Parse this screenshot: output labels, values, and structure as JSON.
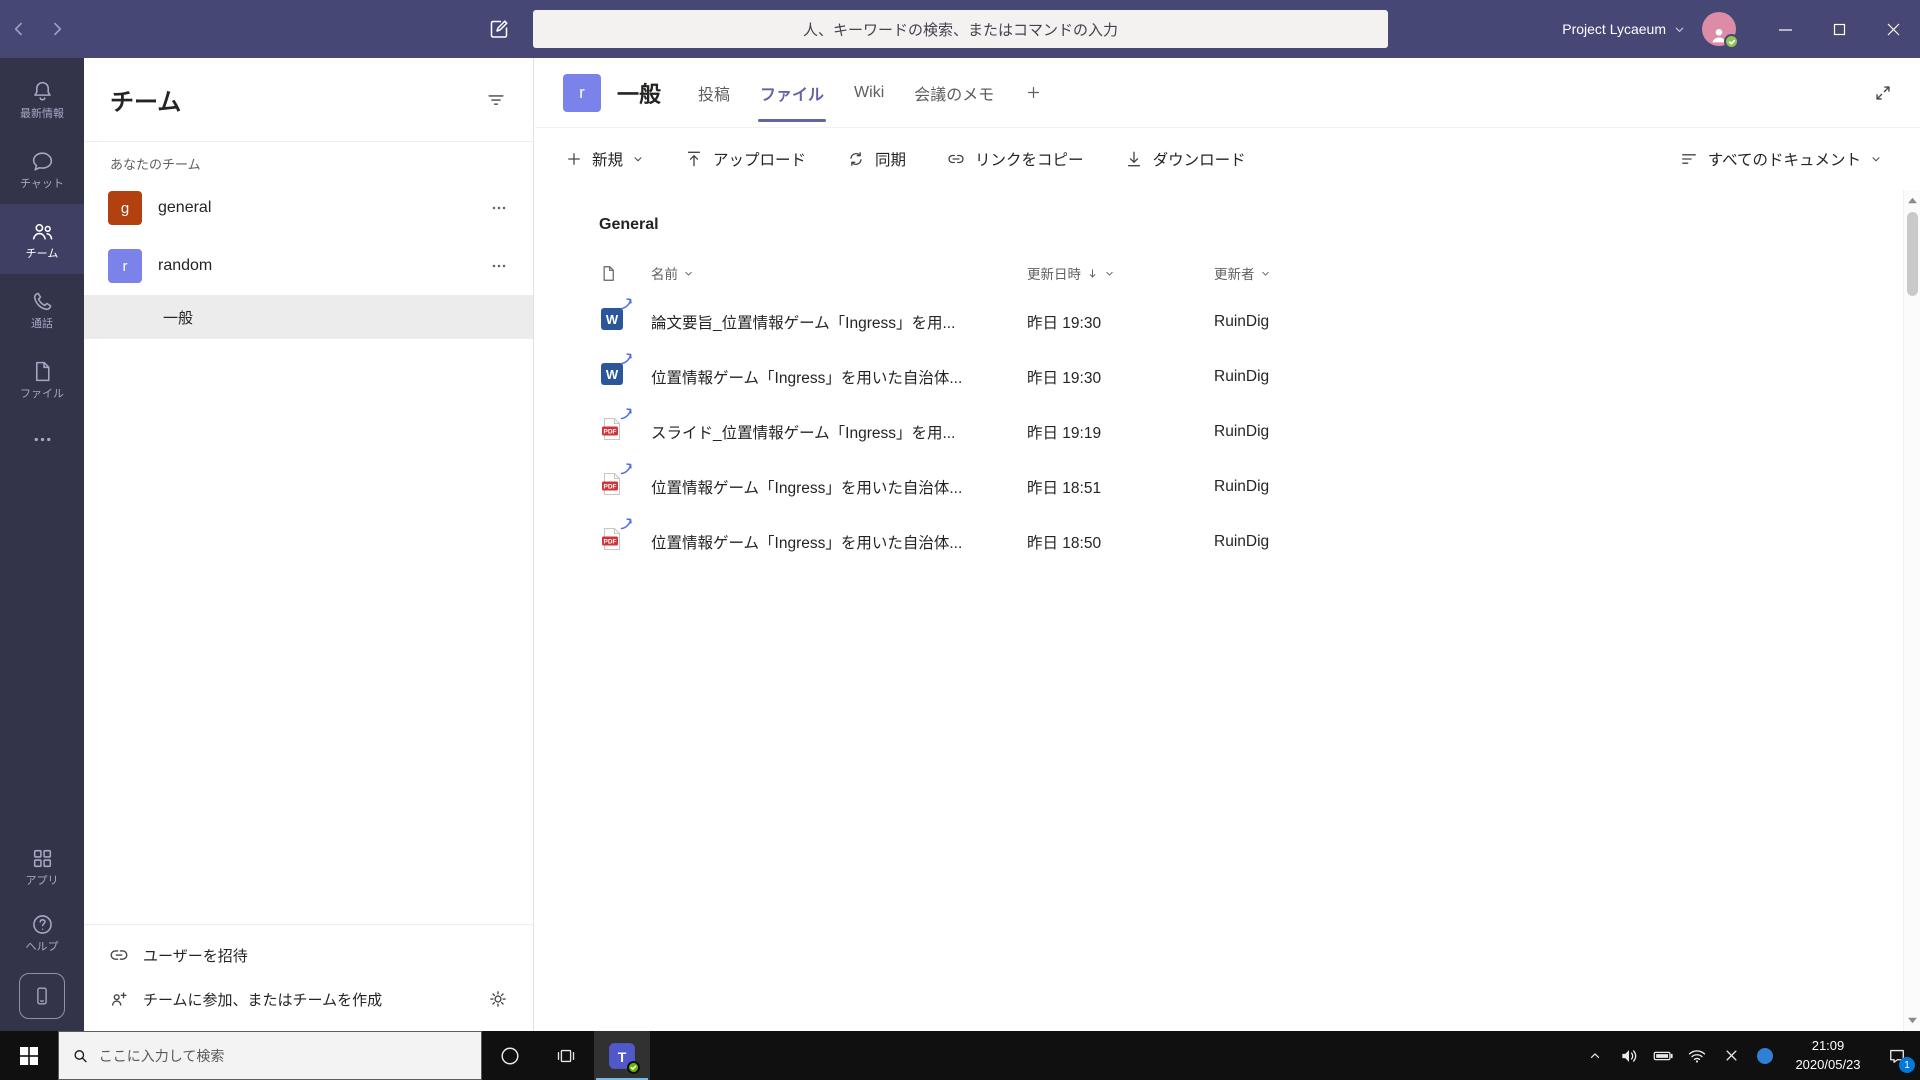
{
  "colors": {
    "accent": "#6264a7",
    "titlebar": "#464775",
    "rail": "#33344a",
    "presence_green": "#92c353",
    "word_blue": "#2b579a",
    "pdf_red": "#d13438",
    "team_general": "#b3400f",
    "team_random": "#7b83eb"
  },
  "titlebar": {
    "search_placeholder": "人、キーワードの検索、またはコマンドの入力",
    "org_name": "Project Lycaeum"
  },
  "rail": {
    "items": [
      {
        "label": "最新情報"
      },
      {
        "label": "チャット"
      },
      {
        "label": "チーム"
      },
      {
        "label": "通話"
      },
      {
        "label": "ファイル"
      }
    ],
    "bottom_items": [
      {
        "label": "アプリ"
      },
      {
        "label": "ヘルプ"
      }
    ]
  },
  "sidebar": {
    "title": "チーム",
    "section": "あなたのチーム",
    "teams": [
      {
        "name": "general",
        "initial": "g"
      },
      {
        "name": "random",
        "initial": "r"
      }
    ],
    "selected_channel": "一般",
    "invite": "ユーザーを招待",
    "join": "チームに参加、またはチームを作成"
  },
  "main": {
    "channel_initial": "r",
    "channel_title": "一般",
    "tabs": [
      {
        "label": "投稿"
      },
      {
        "label": "ファイル"
      },
      {
        "label": "Wiki"
      },
      {
        "label": "会議のメモ"
      }
    ],
    "toolbar": {
      "new_label": "新規",
      "upload_label": "アップロード",
      "sync_label": "同期",
      "copy_link_label": "リンクをコピー",
      "download_label": "ダウンロード",
      "view_label": "すべてのドキュメント"
    },
    "folder_title": "General",
    "table": {
      "col_name": "名前",
      "col_modified": "更新日時",
      "col_author": "更新者",
      "rows": [
        {
          "type": "word",
          "name": "論文要旨_位置情報ゲーム「Ingress」を用...",
          "modified": "昨日 19:30",
          "author": "RuinDig"
        },
        {
          "type": "word",
          "name": "位置情報ゲーム「Ingress」を用いた自治体...",
          "modified": "昨日 19:30",
          "author": "RuinDig"
        },
        {
          "type": "pdf",
          "name": "スライド_位置情報ゲーム「Ingress」を用...",
          "modified": "昨日 19:19",
          "author": "RuinDig"
        },
        {
          "type": "pdf",
          "name": "位置情報ゲーム「Ingress」を用いた自治体...",
          "modified": "昨日 18:51",
          "author": "RuinDig"
        },
        {
          "type": "pdf",
          "name": "位置情報ゲーム「Ingress」を用いた自治体...",
          "modified": "昨日 18:50",
          "author": "RuinDig"
        }
      ]
    }
  },
  "taskbar": {
    "search_placeholder": "ここに入力して検索",
    "clock_time": "21:09",
    "clock_date": "2020/05/23",
    "notification_count": "1"
  }
}
